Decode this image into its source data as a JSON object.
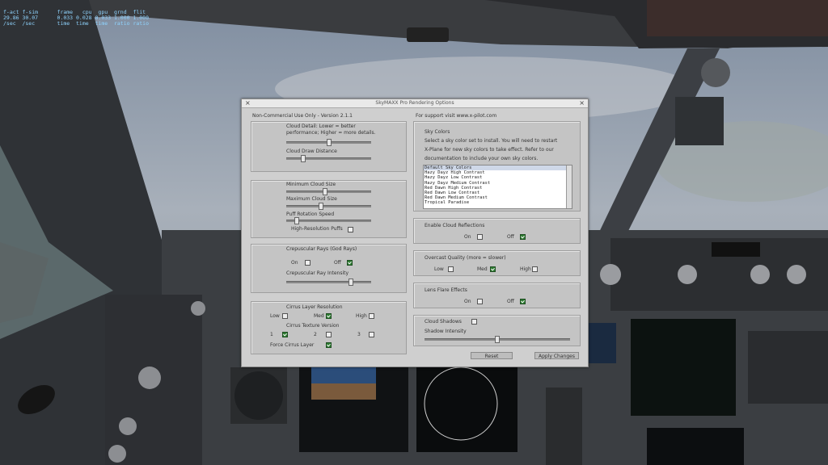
{
  "sim_stats": {
    "line1": "f-act f-sim      frame   cpu  gpu  grnd  flit",
    "line2": "29.86 30.07      0.033 0.028 0.033 1.000 1.000",
    "line3": "/sec  /sec       time  time  time  ratio ratio"
  },
  "dialog": {
    "title": "SkyMAXX Pro Rendering Options",
    "left_header": "Non-Commercial Use Only - Version 2.1.1",
    "right_header": "For support visit www.x-pilot.com",
    "cloud_detail": {
      "label_line1": "Cloud Detail: Lower = better",
      "label_line2": "performance; Higher = more details.",
      "level": 0.5
    },
    "cloud_draw_distance": {
      "label": "Cloud Draw Distance",
      "level": 0.18
    },
    "minimum_cloud_size": {
      "label": "Minimum Cloud Size",
      "level": 0.45
    },
    "maximum_cloud_size": {
      "label": "Maximum Cloud Size",
      "level": 0.4
    },
    "puff_rotation_speed": {
      "label": "Puff Rotation Speed",
      "level": 0.1
    },
    "high_res_puffs": {
      "label": "High-Resolution Puffs",
      "checked": false
    },
    "crepuscular": {
      "title": "Crepuscular Rays (God Rays)",
      "on_label": "On",
      "on_checked": false,
      "off_label": "Off",
      "off_checked": true,
      "intensity_label": "Crepuscular Ray Intensity",
      "intensity_level": 0.78
    },
    "cirrus": {
      "resolution_title": "Cirrus Layer Resolution",
      "low_label": "Low",
      "low_checked": false,
      "med_label": "Med",
      "med_checked": true,
      "high_label": "High",
      "high_checked": false,
      "texture_title": "Cirrus Texture Version",
      "v1_label": "1",
      "v1_checked": true,
      "v2_label": "2",
      "v2_checked": false,
      "v3_label": "3",
      "v3_checked": false,
      "force_label": "Force Cirrus Layer",
      "force_checked": true
    },
    "sky_colors": {
      "title": "Sky Colors",
      "desc_line1": "Select a sky color set to install. You will need to restart",
      "desc_line2": "X-Plane for new sky colors to take effect. Refer to our",
      "desc_line3": "documentation to include your own sky colors.",
      "items": [
        "Default Sky Colors",
        "Hazy Dayz High Contrast",
        "Hazy Dayz Low Contrast",
        "Hazy Dayz Medium Contrast",
        "Red Dawn High Contrast",
        "Red Dawn Low Contrast",
        "Red Dawn Medium Contrast",
        "Tropical Paradise"
      ],
      "selected_index": 0
    },
    "cloud_reflections": {
      "title": "Enable Cloud Reflections",
      "on_label": "On",
      "on_checked": false,
      "off_label": "Off",
      "off_checked": true
    },
    "overcast_quality": {
      "title": "Overcast Quality (more = slower)",
      "low_label": "Low",
      "low_checked": false,
      "med_label": "Med",
      "med_checked": true,
      "high_label": "High",
      "high_checked": false
    },
    "lens_flare": {
      "title": "Lens Flare Effects",
      "on_label": "On",
      "on_checked": false,
      "off_label": "Off",
      "off_checked": true
    },
    "cloud_shadows": {
      "title": "Cloud Shadows",
      "checked": false,
      "intensity_label": "Shadow Intensity",
      "intensity_level": 0.5
    },
    "reset_label": "Reset",
    "apply_label": "Apply Changes"
  },
  "colors": {
    "checkbox_on": "#2e7d32",
    "dialog_bg": "#cfcfcf"
  }
}
